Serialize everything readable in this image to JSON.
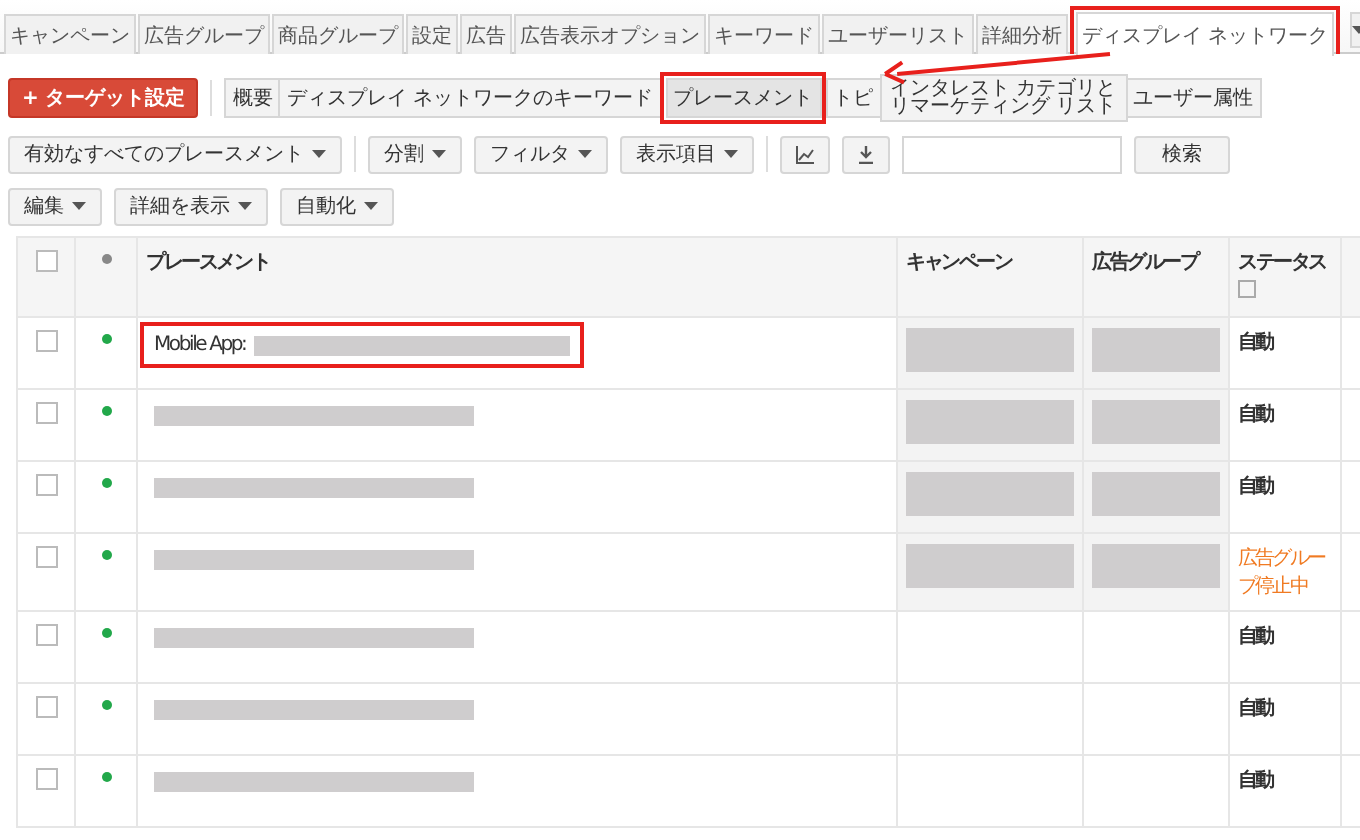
{
  "tabs": [
    {
      "label": "キャンペーン",
      "selected": false,
      "highlighted": false
    },
    {
      "label": "広告グループ",
      "selected": false,
      "highlighted": false
    },
    {
      "label": "商品グループ",
      "selected": false,
      "highlighted": false
    },
    {
      "label": "設定",
      "selected": false,
      "highlighted": false
    },
    {
      "label": "広告",
      "selected": false,
      "highlighted": false
    },
    {
      "label": "広告表示オプション",
      "selected": false,
      "highlighted": false
    },
    {
      "label": "キーワード",
      "selected": false,
      "highlighted": false
    },
    {
      "label": "ユーザーリスト",
      "selected": false,
      "highlighted": false
    },
    {
      "label": "詳細分析",
      "selected": false,
      "highlighted": false
    },
    {
      "label": "ディスプレイ ネットワーク",
      "selected": true,
      "highlighted": true
    }
  ],
  "add_target_button": {
    "icon": "+",
    "label": "ターゲット設定"
  },
  "subtabs": [
    {
      "label": "概要",
      "selected": false,
      "highlighted": false
    },
    {
      "label": "ディスプレイ ネットワークのキーワード",
      "selected": false,
      "highlighted": false
    },
    {
      "label": "プレースメント",
      "selected": true,
      "highlighted": true
    },
    {
      "label": "トピ",
      "selected": false,
      "highlighted": false
    },
    {
      "label": "インタレスト カテゴリとリマーケティング リスト",
      "selected": false,
      "highlighted": false
    },
    {
      "label": "ユーザー属性",
      "selected": false,
      "highlighted": false
    }
  ],
  "toolbar": [
    {
      "kind": "dropdown",
      "label": "有効なすべてのプレースメント"
    },
    {
      "kind": "dropdown",
      "label": "分割"
    },
    {
      "kind": "dropdown",
      "label": "フィルタ"
    },
    {
      "kind": "dropdown",
      "label": "表示項目"
    },
    {
      "kind": "chart"
    },
    {
      "kind": "download"
    }
  ],
  "search_button": "検索",
  "actions": [
    "編集",
    "詳細を表示",
    "自動化"
  ],
  "table": {
    "select_all_checked": false,
    "columns": [
      "プレースメント",
      "キャンペーン",
      "広告グループ",
      "ステータス"
    ],
    "rows": [
      {
        "checked": false,
        "color": "#22a84a",
        "placement": "Mobile App:",
        "placement_redacted": true,
        "highlighted": true,
        "campaign_redacted": true,
        "status": "自動",
        "kind": "enabled"
      },
      {
        "checked": false,
        "color": "#22a84a",
        "placement_redacted": true,
        "highlighted": false,
        "campaign_redacted": true,
        "status": "自動",
        "kind": "enabled"
      },
      {
        "checked": false,
        "color": "#22a84a",
        "placement_redacted": true,
        "highlighted": false,
        "campaign_redacted": true,
        "status": "自動",
        "kind": "enabled"
      },
      {
        "checked": false,
        "color": "#22a84a",
        "placement_redacted": true,
        "highlighted": false,
        "campaign_redacted": true,
        "status": "広告グループ停止中",
        "kind": "paused"
      },
      {
        "checked": false,
        "color": "#22a84a",
        "placement_redacted": true,
        "highlighted": false,
        "campaign_redacted": false,
        "status": "自動",
        "kind": "enabled"
      },
      {
        "checked": false,
        "color": "#22a84a",
        "placement_redacted": true,
        "highlighted": false,
        "campaign_redacted": false,
        "status": "自動",
        "kind": "enabled"
      },
      {
        "checked": false,
        "color": "#22a84a",
        "placement_redacted": true,
        "highlighted": false,
        "campaign_redacted": false,
        "status": "自動",
        "kind": "enabled"
      }
    ]
  }
}
